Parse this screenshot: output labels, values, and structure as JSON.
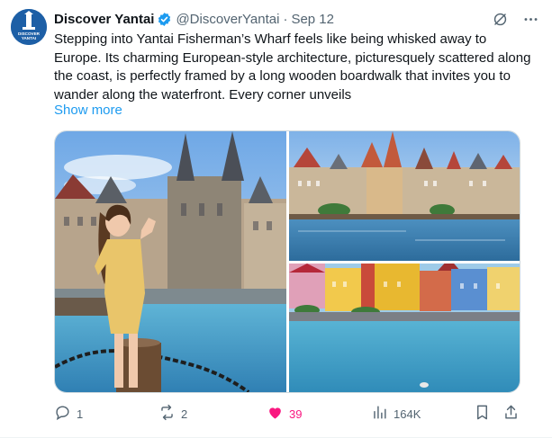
{
  "account": {
    "display_name": "Discover Yantai",
    "handle": "@DiscoverYantai",
    "separator": "·",
    "date": "Sep 12",
    "verified": true,
    "avatar_text": "DISCOVER YANTAI"
  },
  "post": {
    "text": "Stepping into Yantai Fisherman’s Wharf feels like being whisked away to Europe. Its charming European-style architecture, picturesquely scattered along the coast, is perfectly framed by a long wooden boardwalk that invites you to wander along the waterfront. Every corner unveils",
    "show_more": "Show more"
  },
  "media": [
    {
      "subject": "woman-posing-by-harbor-railing"
    },
    {
      "subject": "european-style-buildings-across-water"
    },
    {
      "subject": "colorful-waterfront-buildings"
    }
  ],
  "actions": {
    "replies": "1",
    "reposts": "2",
    "likes": "39",
    "views": "164K"
  },
  "colors": {
    "accent": "#1d9bf0",
    "like": "#f91880",
    "secondary_text": "#536471",
    "verified_badge": "#1d9bf0"
  },
  "icons": [
    "verified-badge-icon",
    "grok-icon",
    "more-icon",
    "reply-icon",
    "repost-icon",
    "like-icon",
    "views-icon",
    "bookmark-icon",
    "share-icon"
  ]
}
